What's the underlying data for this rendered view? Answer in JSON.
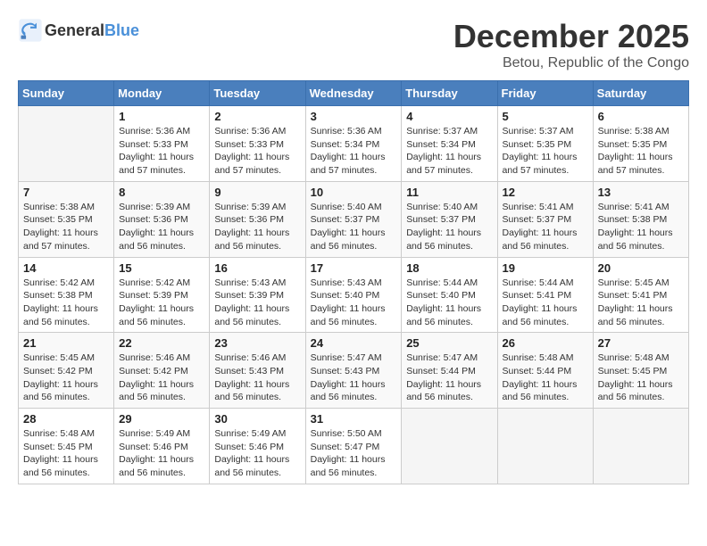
{
  "logo": {
    "general": "General",
    "blue": "Blue"
  },
  "title": "December 2025",
  "location": "Betou, Republic of the Congo",
  "days_of_week": [
    "Sunday",
    "Monday",
    "Tuesday",
    "Wednesday",
    "Thursday",
    "Friday",
    "Saturday"
  ],
  "weeks": [
    [
      {
        "day": "",
        "info": ""
      },
      {
        "day": "1",
        "info": "Sunrise: 5:36 AM\nSunset: 5:33 PM\nDaylight: 11 hours\nand 57 minutes."
      },
      {
        "day": "2",
        "info": "Sunrise: 5:36 AM\nSunset: 5:33 PM\nDaylight: 11 hours\nand 57 minutes."
      },
      {
        "day": "3",
        "info": "Sunrise: 5:36 AM\nSunset: 5:34 PM\nDaylight: 11 hours\nand 57 minutes."
      },
      {
        "day": "4",
        "info": "Sunrise: 5:37 AM\nSunset: 5:34 PM\nDaylight: 11 hours\nand 57 minutes."
      },
      {
        "day": "5",
        "info": "Sunrise: 5:37 AM\nSunset: 5:35 PM\nDaylight: 11 hours\nand 57 minutes."
      },
      {
        "day": "6",
        "info": "Sunrise: 5:38 AM\nSunset: 5:35 PM\nDaylight: 11 hours\nand 57 minutes."
      }
    ],
    [
      {
        "day": "7",
        "info": "Sunrise: 5:38 AM\nSunset: 5:35 PM\nDaylight: 11 hours\nand 57 minutes."
      },
      {
        "day": "8",
        "info": "Sunrise: 5:39 AM\nSunset: 5:36 PM\nDaylight: 11 hours\nand 56 minutes."
      },
      {
        "day": "9",
        "info": "Sunrise: 5:39 AM\nSunset: 5:36 PM\nDaylight: 11 hours\nand 56 minutes."
      },
      {
        "day": "10",
        "info": "Sunrise: 5:40 AM\nSunset: 5:37 PM\nDaylight: 11 hours\nand 56 minutes."
      },
      {
        "day": "11",
        "info": "Sunrise: 5:40 AM\nSunset: 5:37 PM\nDaylight: 11 hours\nand 56 minutes."
      },
      {
        "day": "12",
        "info": "Sunrise: 5:41 AM\nSunset: 5:37 PM\nDaylight: 11 hours\nand 56 minutes."
      },
      {
        "day": "13",
        "info": "Sunrise: 5:41 AM\nSunset: 5:38 PM\nDaylight: 11 hours\nand 56 minutes."
      }
    ],
    [
      {
        "day": "14",
        "info": "Sunrise: 5:42 AM\nSunset: 5:38 PM\nDaylight: 11 hours\nand 56 minutes."
      },
      {
        "day": "15",
        "info": "Sunrise: 5:42 AM\nSunset: 5:39 PM\nDaylight: 11 hours\nand 56 minutes."
      },
      {
        "day": "16",
        "info": "Sunrise: 5:43 AM\nSunset: 5:39 PM\nDaylight: 11 hours\nand 56 minutes."
      },
      {
        "day": "17",
        "info": "Sunrise: 5:43 AM\nSunset: 5:40 PM\nDaylight: 11 hours\nand 56 minutes."
      },
      {
        "day": "18",
        "info": "Sunrise: 5:44 AM\nSunset: 5:40 PM\nDaylight: 11 hours\nand 56 minutes."
      },
      {
        "day": "19",
        "info": "Sunrise: 5:44 AM\nSunset: 5:41 PM\nDaylight: 11 hours\nand 56 minutes."
      },
      {
        "day": "20",
        "info": "Sunrise: 5:45 AM\nSunset: 5:41 PM\nDaylight: 11 hours\nand 56 minutes."
      }
    ],
    [
      {
        "day": "21",
        "info": "Sunrise: 5:45 AM\nSunset: 5:42 PM\nDaylight: 11 hours\nand 56 minutes."
      },
      {
        "day": "22",
        "info": "Sunrise: 5:46 AM\nSunset: 5:42 PM\nDaylight: 11 hours\nand 56 minutes."
      },
      {
        "day": "23",
        "info": "Sunrise: 5:46 AM\nSunset: 5:43 PM\nDaylight: 11 hours\nand 56 minutes."
      },
      {
        "day": "24",
        "info": "Sunrise: 5:47 AM\nSunset: 5:43 PM\nDaylight: 11 hours\nand 56 minutes."
      },
      {
        "day": "25",
        "info": "Sunrise: 5:47 AM\nSunset: 5:44 PM\nDaylight: 11 hours\nand 56 minutes."
      },
      {
        "day": "26",
        "info": "Sunrise: 5:48 AM\nSunset: 5:44 PM\nDaylight: 11 hours\nand 56 minutes."
      },
      {
        "day": "27",
        "info": "Sunrise: 5:48 AM\nSunset: 5:45 PM\nDaylight: 11 hours\nand 56 minutes."
      }
    ],
    [
      {
        "day": "28",
        "info": "Sunrise: 5:48 AM\nSunset: 5:45 PM\nDaylight: 11 hours\nand 56 minutes."
      },
      {
        "day": "29",
        "info": "Sunrise: 5:49 AM\nSunset: 5:46 PM\nDaylight: 11 hours\nand 56 minutes."
      },
      {
        "day": "30",
        "info": "Sunrise: 5:49 AM\nSunset: 5:46 PM\nDaylight: 11 hours\nand 56 minutes."
      },
      {
        "day": "31",
        "info": "Sunrise: 5:50 AM\nSunset: 5:47 PM\nDaylight: 11 hours\nand 56 minutes."
      },
      {
        "day": "",
        "info": ""
      },
      {
        "day": "",
        "info": ""
      },
      {
        "day": "",
        "info": ""
      }
    ]
  ]
}
